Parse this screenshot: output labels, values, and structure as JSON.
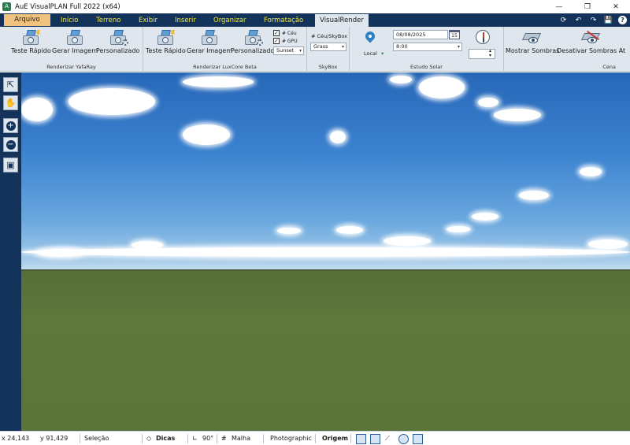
{
  "window": {
    "title": "AuE VisualPLAN Full 2022 (x64)",
    "controls": {
      "minimize": "—",
      "maximize": "❐",
      "close": "✕"
    }
  },
  "tabs": [
    {
      "label": "Arquivo"
    },
    {
      "label": "Início"
    },
    {
      "label": "Terreno"
    },
    {
      "label": "Exibir"
    },
    {
      "label": "Inserir"
    },
    {
      "label": "Organizar"
    },
    {
      "label": "Formatação"
    },
    {
      "label": "VisualRender"
    }
  ],
  "active_tab": "VisualRender",
  "quick_access": {
    "refresh": "⟳",
    "undo": "↶",
    "redo": "↷",
    "save": "💾",
    "help": "?"
  },
  "ribbon": {
    "yafaray": {
      "label": "Renderizar YafaRay",
      "buttons": [
        "Teste Rápido",
        "Gerar Imagem",
        "Personalizado"
      ]
    },
    "luxcore": {
      "label": "Renderizar LuxCore Beta",
      "buttons": [
        "Teste Rápido",
        "Gerar Imagem",
        "Personalizado"
      ],
      "check_sky": "# Céu",
      "check_gpu": "# GPU",
      "sky_preset": "Sunset"
    },
    "skybox": {
      "label": "SkyBox",
      "sky_label": "# Céu/SkyBox",
      "ground": "Grass"
    },
    "solar": {
      "label": "Estudo Solar",
      "local": "Local",
      "date": "08/08/2025",
      "calendar": "15",
      "time": "8:00"
    },
    "scene": {
      "label": "Cena",
      "show_shadows": "Mostrar Sombras",
      "hide_shadows": "Desativar Sombras At"
    }
  },
  "status": {
    "x": "x 24,143",
    "y": "y 91,429",
    "selection": "Seleção",
    "tips": "Dicas",
    "angle": "90°",
    "grid": "Malha",
    "render_mode": "Photographic",
    "origin": "Origem"
  }
}
